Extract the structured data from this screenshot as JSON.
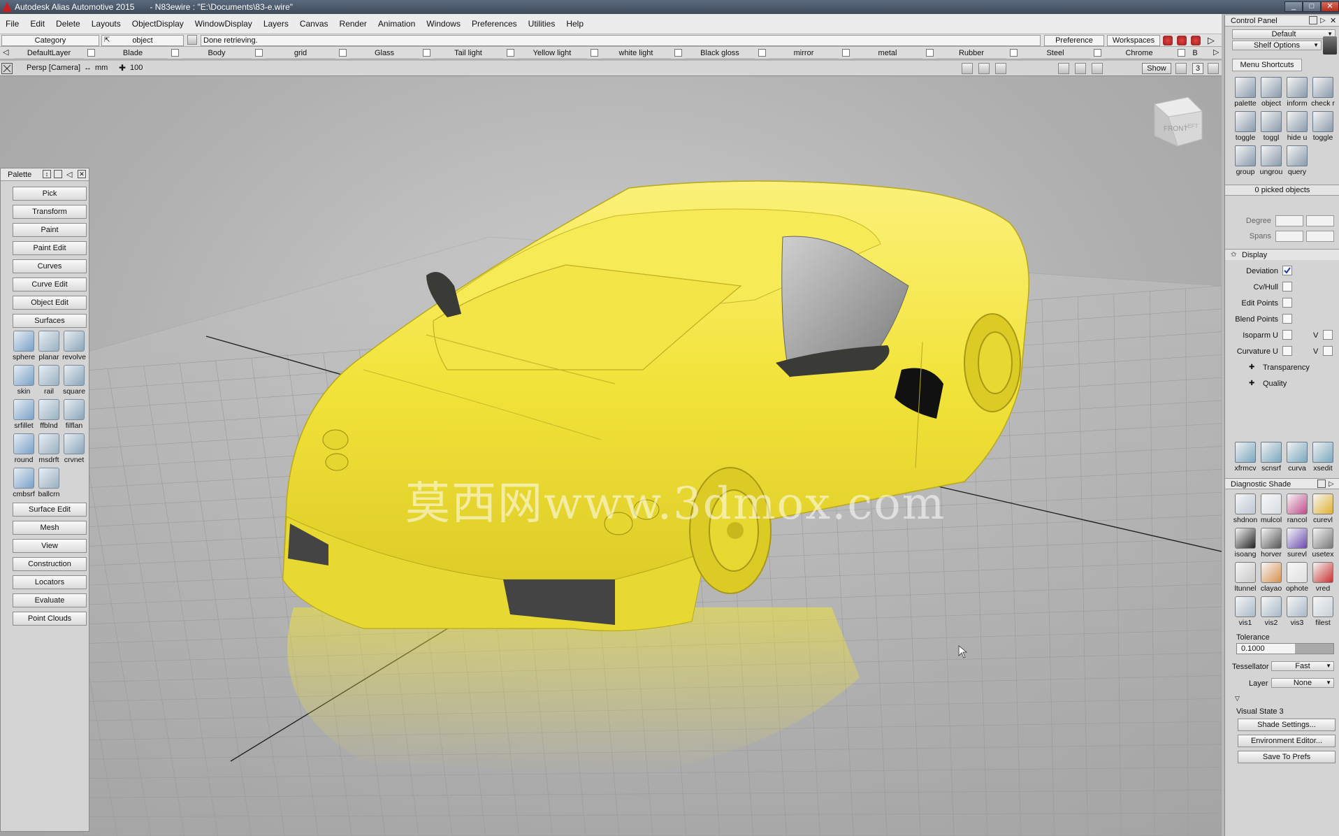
{
  "window": {
    "app_title": "Autodesk Alias Automotive 2015",
    "file_title": "- N83ewire : \"E:\\Documents\\83-e.wire\"",
    "minimize": "_",
    "maximize": "□",
    "close": "✕"
  },
  "menu": [
    "File",
    "Edit",
    "Delete",
    "Layouts",
    "ObjectDisplay",
    "WindowDisplay",
    "Layers",
    "Canvas",
    "Render",
    "Animation",
    "Windows",
    "Preferences",
    "Utilities",
    "Help"
  ],
  "toolbar": {
    "category_label": "Category",
    "object_label": "object",
    "status": "Done retrieving.",
    "preference_sets": "Preference Sets",
    "workspaces": "Workspaces"
  },
  "shelves": [
    "DefaultLayer",
    "Blade",
    "Body",
    "grid",
    "Glass",
    "Tail light",
    "Yellow light",
    "white light",
    "Black gloss",
    "mirror",
    "metal",
    "Rubber",
    "Steel",
    "Chrome",
    "B"
  ],
  "viewport": {
    "camera": "Persp [Camera]",
    "units": "mm",
    "grid": "100",
    "show": "Show",
    "number": "3",
    "cube_front": "FRONT",
    "cube_left": "LEFT"
  },
  "watermark": "莫西网www.3dmox.com",
  "palette": {
    "title": "Palette",
    "top_buttons": [
      "Pick",
      "Transform",
      "Paint",
      "Paint Edit",
      "Curves",
      "Curve Edit",
      "Object Edit",
      "Surfaces"
    ],
    "tools": [
      "sphere",
      "planar",
      "revolve",
      "skin",
      "rail",
      "square",
      "srfillet",
      "ffblnd",
      "filflan",
      "round",
      "msdrft",
      "crvnet",
      "cmbsrf",
      "ballcrn"
    ],
    "bottom_buttons": [
      "Surface Edit",
      "Mesh",
      "View",
      "Construction",
      "Locators",
      "Evaluate",
      "Point Clouds"
    ]
  },
  "control_panel": {
    "title": "Control Panel",
    "preset": "Default",
    "shelf_options": "Shelf Options",
    "menu_shortcuts": "Menu Shortcuts",
    "shortcuts": [
      "palette",
      "object",
      "inform",
      "check r",
      "toggle",
      "toggl",
      "hide u",
      "toggle",
      "group",
      "ungrou",
      "query"
    ],
    "picked": "0 picked objects",
    "degree_label": "Degree",
    "spans_label": "Spans",
    "display_label": "Display",
    "display_options": [
      {
        "label": "Deviation",
        "checked": true
      },
      {
        "label": "Cv/Hull",
        "checked": false
      },
      {
        "label": "Edit Points",
        "checked": false
      },
      {
        "label": "Blend Points",
        "checked": false
      },
      {
        "label": "Isoparm U",
        "checked": false
      },
      {
        "label": "Curvature U",
        "checked": false
      }
    ],
    "v_label": "V",
    "transparency": "Transparency",
    "quality": "Quality",
    "mid_tools": [
      "xfrmcv",
      "scnsrf",
      "curva",
      "xsedit"
    ],
    "diag_title": "Diagnostic Shade",
    "diag_tools": [
      "shdnon",
      "mulcol",
      "rancol",
      "curevl",
      "isoang",
      "horver",
      "surevl",
      "usetex",
      "ltunnel",
      "clayao",
      "ophote",
      "vred",
      "vis1",
      "vis2",
      "vis3",
      "filest"
    ],
    "tolerance_label": "Tolerance",
    "tolerance_value": "0.1000",
    "tessellator_label": "Tessellator",
    "tessellator_value": "Fast",
    "layer_label": "Layer",
    "layer_value": "None",
    "visual_state": "Visual State 3",
    "buttons": [
      "Shade Settings...",
      "Environment Editor...",
      "Save To Prefs"
    ]
  },
  "colors": {
    "car": "#f0e23a",
    "car_shadow": "#c9b81e",
    "glass": "#9a9a9a",
    "titlebar": "#4a5768",
    "accent": "#c62020"
  }
}
